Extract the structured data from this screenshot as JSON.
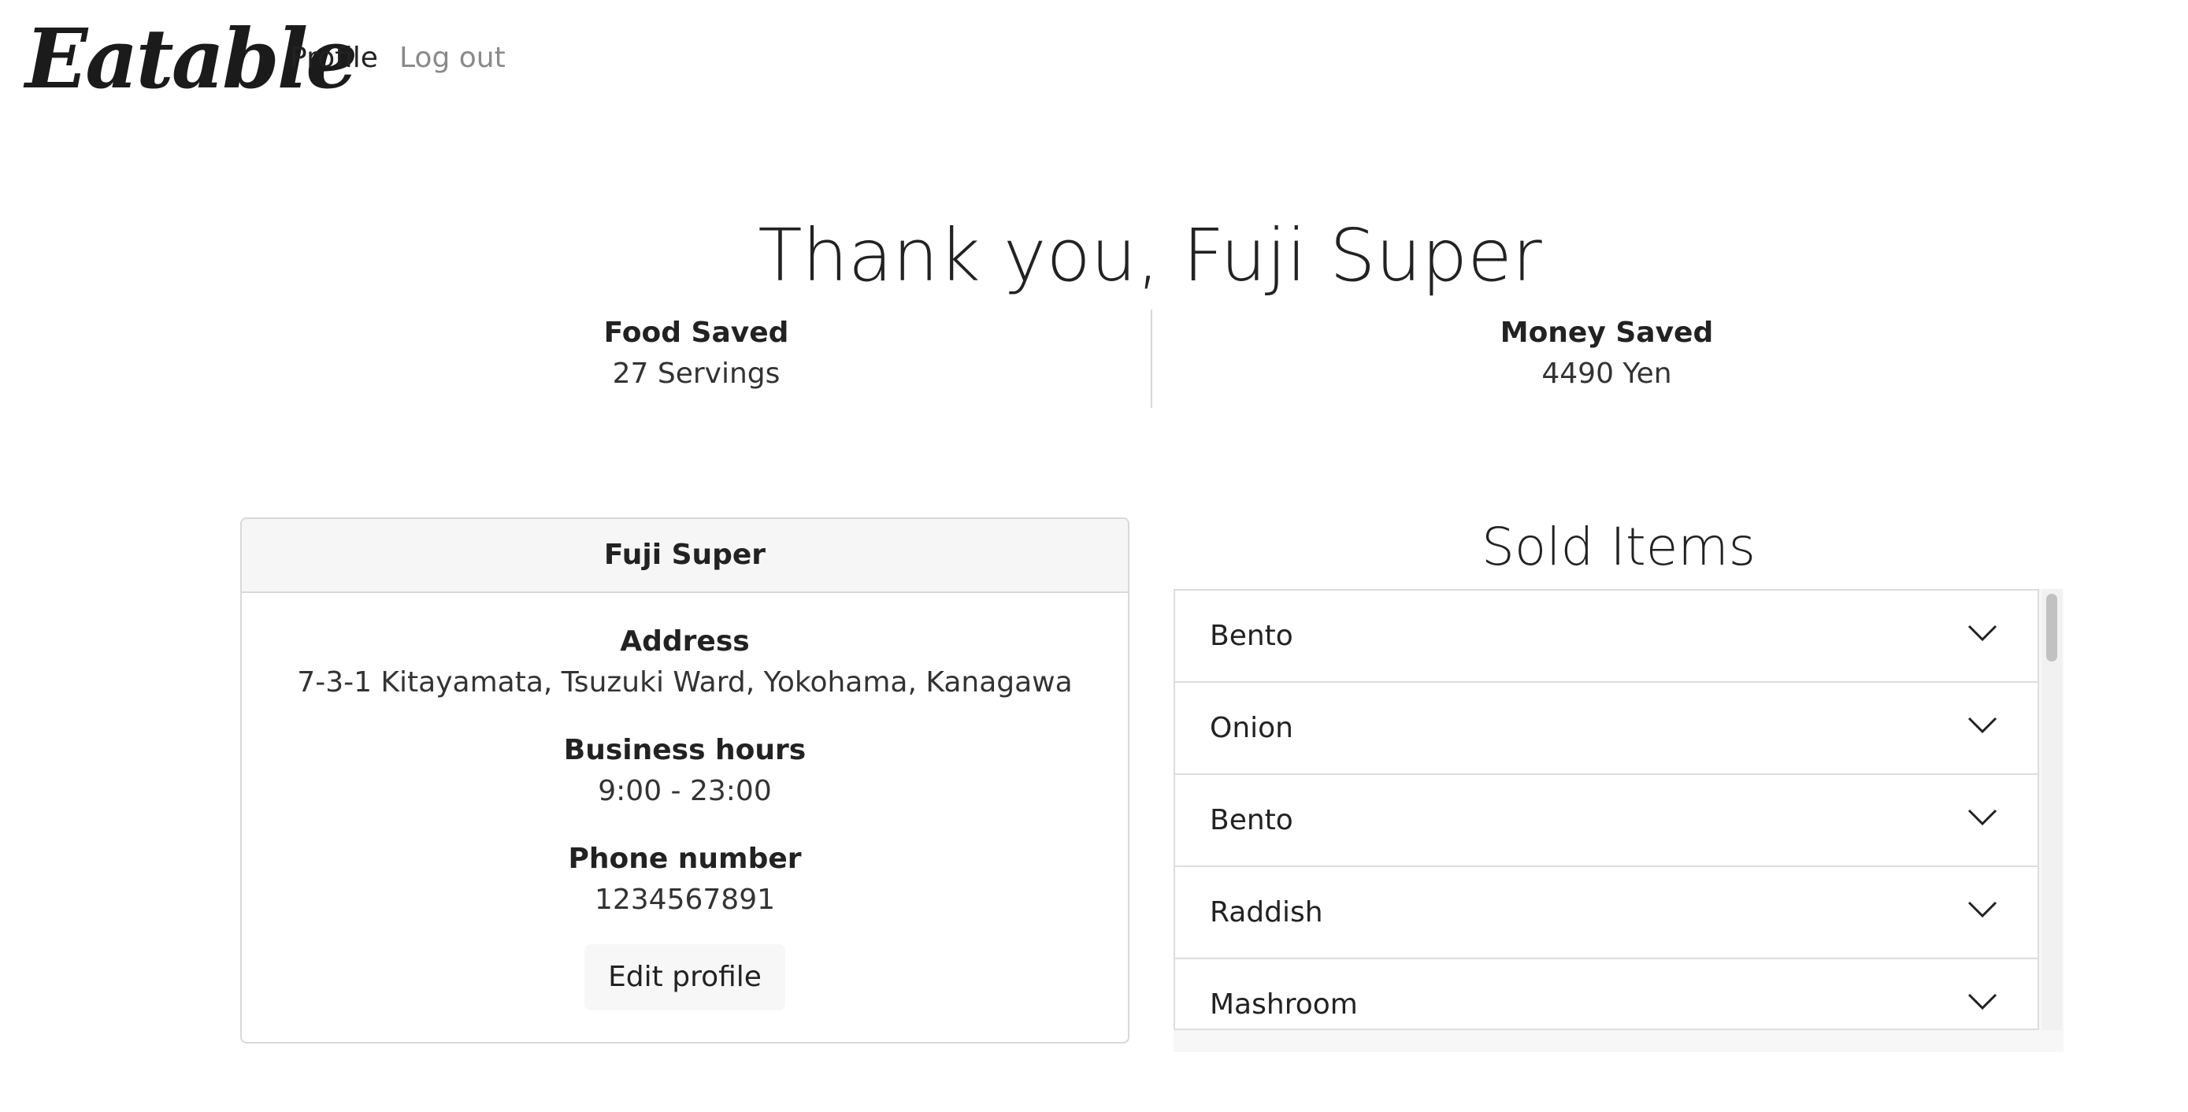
{
  "nav": {
    "brand": "Eatable",
    "profile_label": "Profile",
    "logout_label": "Log out"
  },
  "header": {
    "title": "Thank you, Fuji Super"
  },
  "stats": {
    "food_label": "Food Saved",
    "food_value": "27 Servings",
    "money_label": "Money Saved",
    "money_value": "4490 Yen"
  },
  "store_card": {
    "name": "Fuji Super",
    "address_label": "Address",
    "address": "7-3-1 Kitayamata, Tsuzuki Ward, Yokohama, Kanagawa",
    "hours_label": "Business hours",
    "hours": "9:00 - 23:00",
    "phone_label": "Phone number",
    "phone": "1234567891",
    "edit_button": "Edit profile"
  },
  "sold_items": {
    "title": "Sold Items",
    "items": [
      {
        "label": "Bento",
        "icon": "chevron-down-icon"
      },
      {
        "label": "Onion",
        "icon": "chevron-down-icon"
      },
      {
        "label": "Bento",
        "icon": "chevron-down-icon"
      },
      {
        "label": "Raddish",
        "icon": "chevron-down-icon"
      },
      {
        "label": "Mashroom",
        "icon": "chevron-down-icon"
      }
    ]
  },
  "colors": {
    "text": "#222222",
    "muted_link": "#8a8a8a",
    "border": "#d9d9d9",
    "card_header_bg": "#f6f6f6"
  }
}
